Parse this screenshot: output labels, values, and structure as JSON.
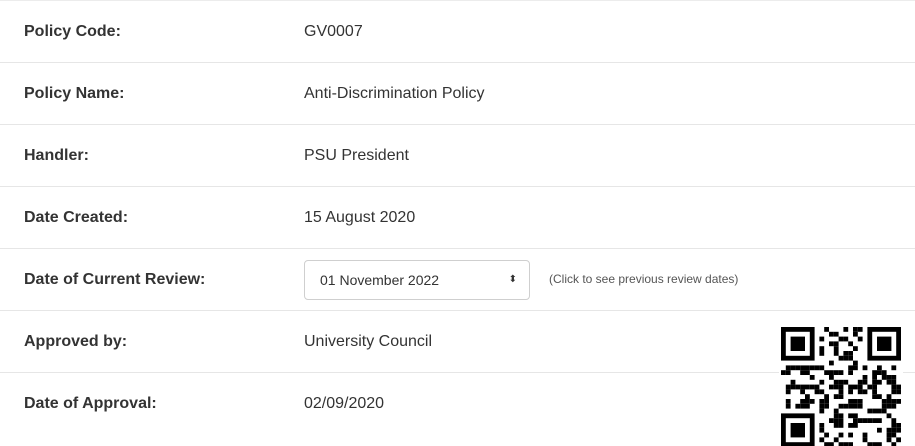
{
  "policy": {
    "rows": [
      {
        "label": "Policy Code:",
        "value": "GV0007"
      },
      {
        "label": "Policy Name:",
        "value": "Anti-Discrimination Policy"
      },
      {
        "label": "Handler:",
        "value": "PSU President"
      },
      {
        "label": "Date Created:",
        "value": "15 August 2020"
      },
      {
        "label": "Date of Current Review:",
        "value": "01 November 2022"
      },
      {
        "label": "Approved by:",
        "value": "University Council"
      },
      {
        "label": "Date of Approval:",
        "value": "02/09/2020"
      }
    ],
    "review_hint": "(Click to see previous review dates)"
  },
  "qr": {
    "icon": "qr-code-icon",
    "color": "#000000"
  }
}
